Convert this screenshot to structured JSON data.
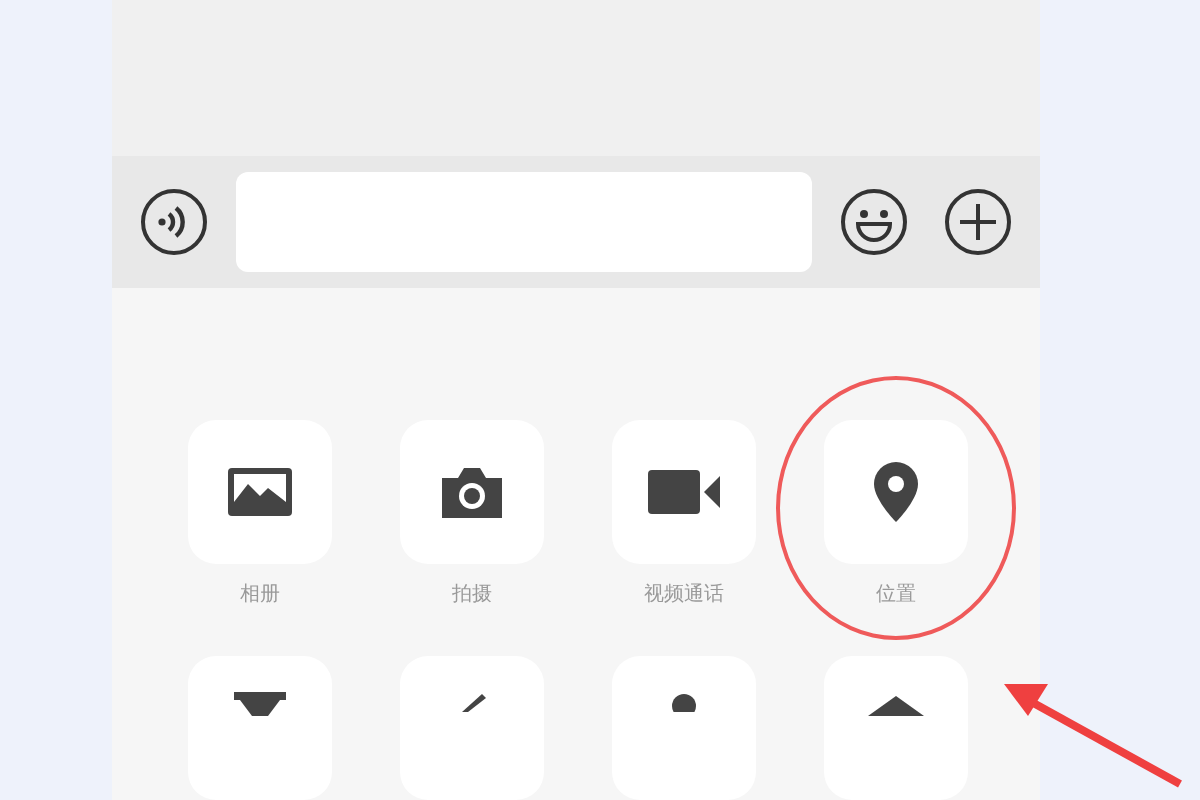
{
  "tiles": [
    {
      "label": "相册",
      "circled": false
    },
    {
      "label": "拍摄",
      "circled": false
    },
    {
      "label": "视频通话",
      "circled": false
    },
    {
      "label": "位置",
      "circled": true
    }
  ]
}
